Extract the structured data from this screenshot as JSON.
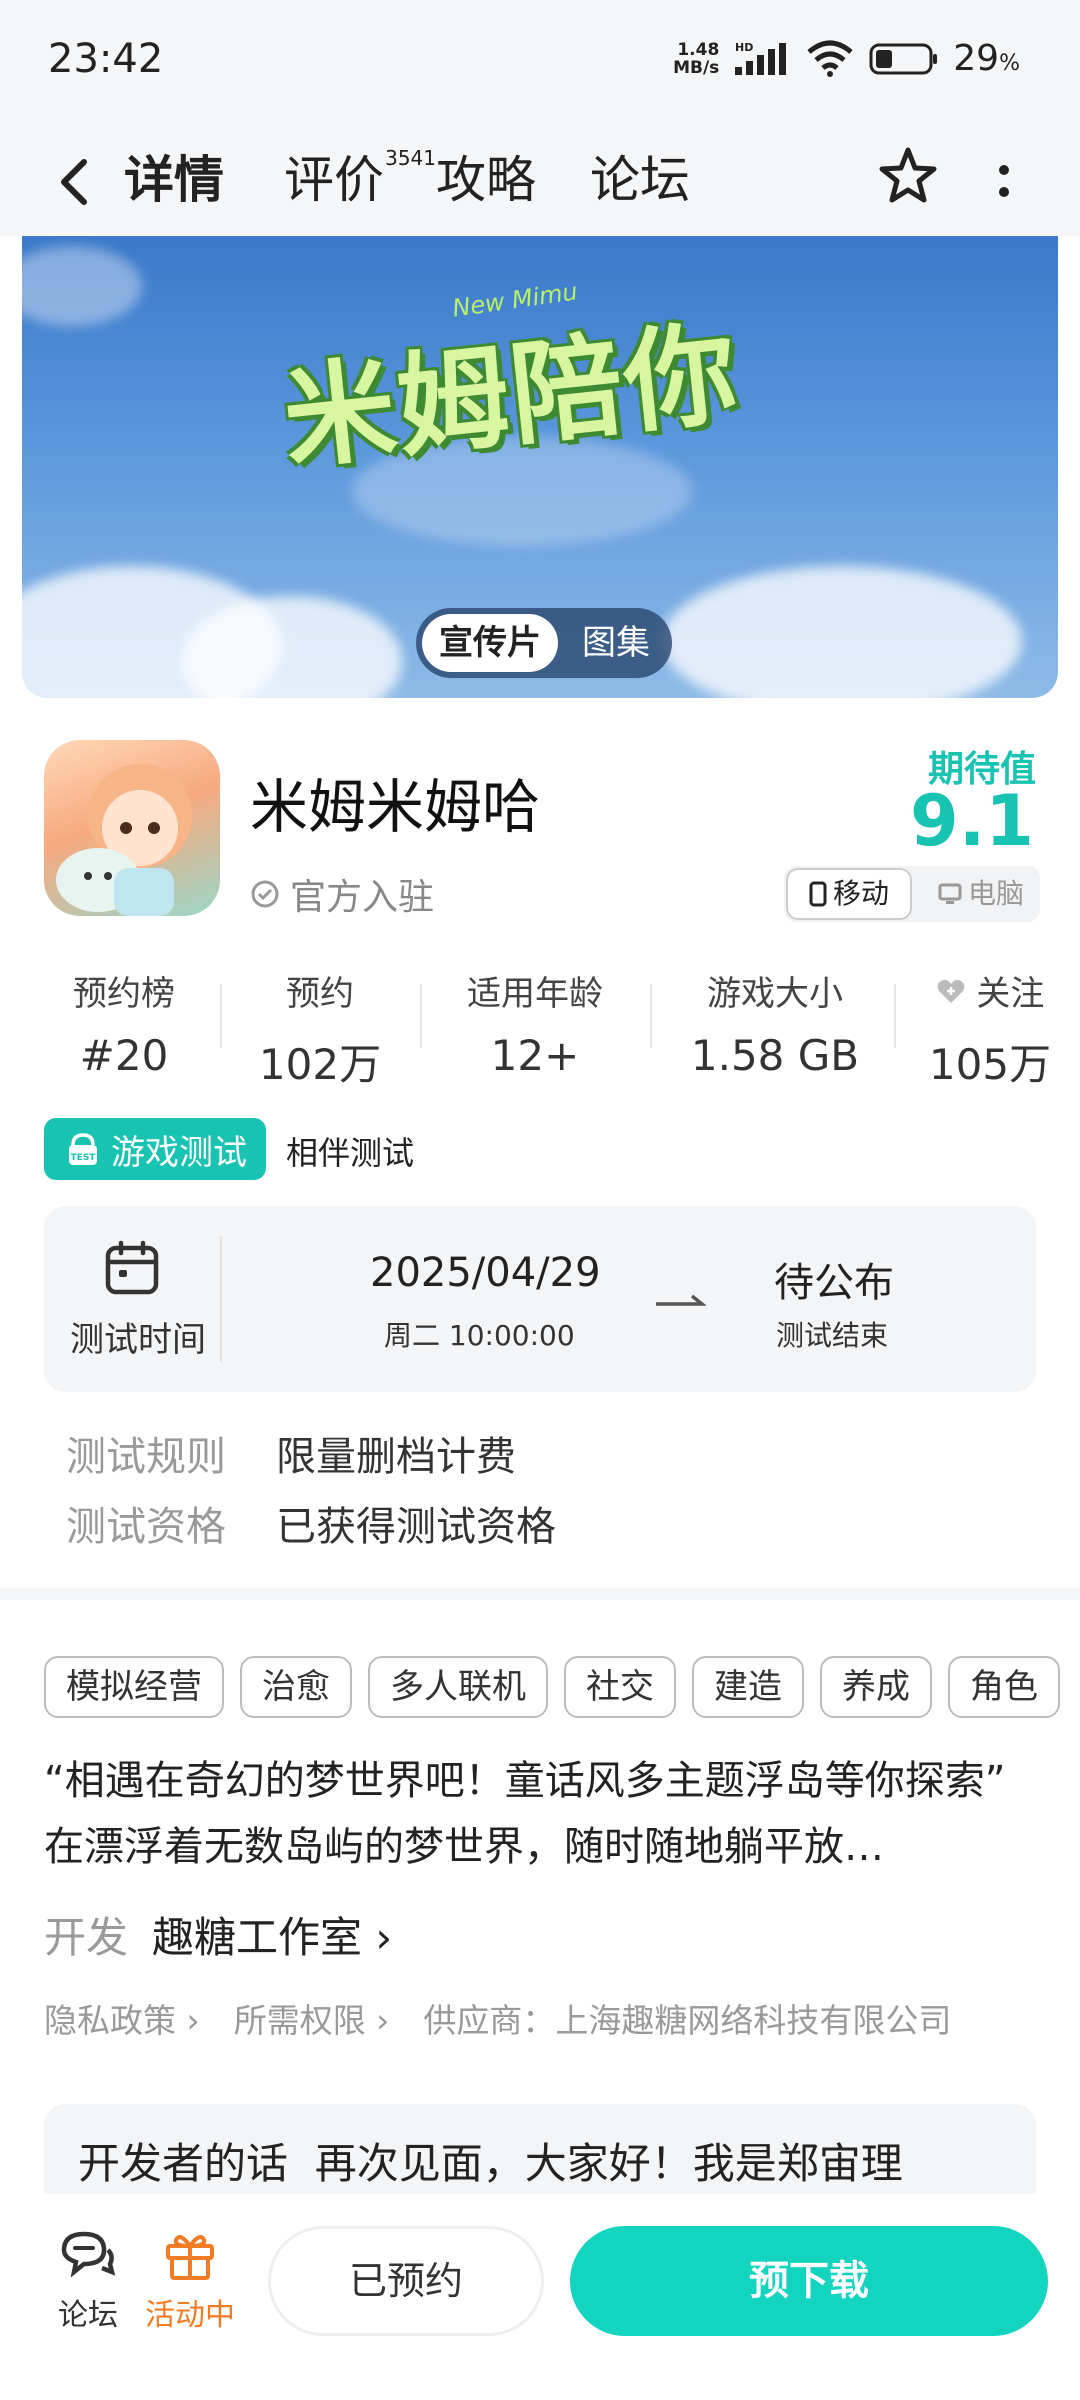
{
  "status_bar": {
    "time": "23:42",
    "speed_value": "1.48",
    "speed_unit": "MB/s",
    "network": "HD",
    "battery": "29",
    "battery_unit": "%"
  },
  "nav": {
    "tabs": [
      {
        "label": "详情"
      },
      {
        "label": "评价",
        "badge": "3541"
      },
      {
        "label": "攻略"
      },
      {
        "label": "论坛"
      }
    ]
  },
  "banner": {
    "logo_text": "米姆陪你",
    "logo_sub": "New Mimu",
    "toggle_active": "宣传片",
    "toggle_inactive": "图集"
  },
  "game": {
    "name": "米姆米姆哈",
    "official": "官方入驻",
    "expectation_label": "期待值",
    "expectation_value": "9.1",
    "platform_mobile": "移动",
    "platform_pc": "电脑"
  },
  "stats": [
    {
      "label": "预约榜",
      "value": "#20"
    },
    {
      "label": "预约",
      "value": "102万"
    },
    {
      "label": "适用年龄",
      "value": "12+"
    },
    {
      "label": "游戏大小",
      "value": "1.58 GB"
    },
    {
      "label": "关注",
      "value": "105万"
    }
  ],
  "test": {
    "badge": "游戏测试",
    "badge_icon_text": "TEST",
    "type": "相伴测试",
    "time_label": "测试时间",
    "start_date": "2025/04/29",
    "start_sub": "周二  10:00:00",
    "end_status": "待公布",
    "end_label": "测试结束",
    "rules": [
      {
        "key": "测试规则",
        "value": "限量删档计费"
      },
      {
        "key": "测试资格",
        "value": "已获得测试资格"
      }
    ]
  },
  "tags": [
    "模拟经营",
    "治愈",
    "多人联机",
    "社交",
    "建造",
    "养成",
    "角色"
  ],
  "description": "“相遇在奇幻的梦世界吧！童话风多主题浮岛等你探索” 在漂浮着无数岛屿的梦世界，随时随地躺平放…",
  "developer": {
    "label": "开发",
    "name": "趣糖工作室 ›"
  },
  "links": [
    "隐私政策 ›",
    "所需权限 ›",
    "供应商：上海趣糖网络科技有限公司"
  ],
  "dev_words": {
    "title": "开发者的话",
    "text": "再次见面，大家好！我是郑宙理"
  },
  "bottom_bar": {
    "forum": "论坛",
    "activity": "活动中",
    "reserved": "已预约",
    "predownload": "预下载"
  },
  "colors": {
    "accent": "#18c4b1",
    "activity": "#f27b26"
  }
}
